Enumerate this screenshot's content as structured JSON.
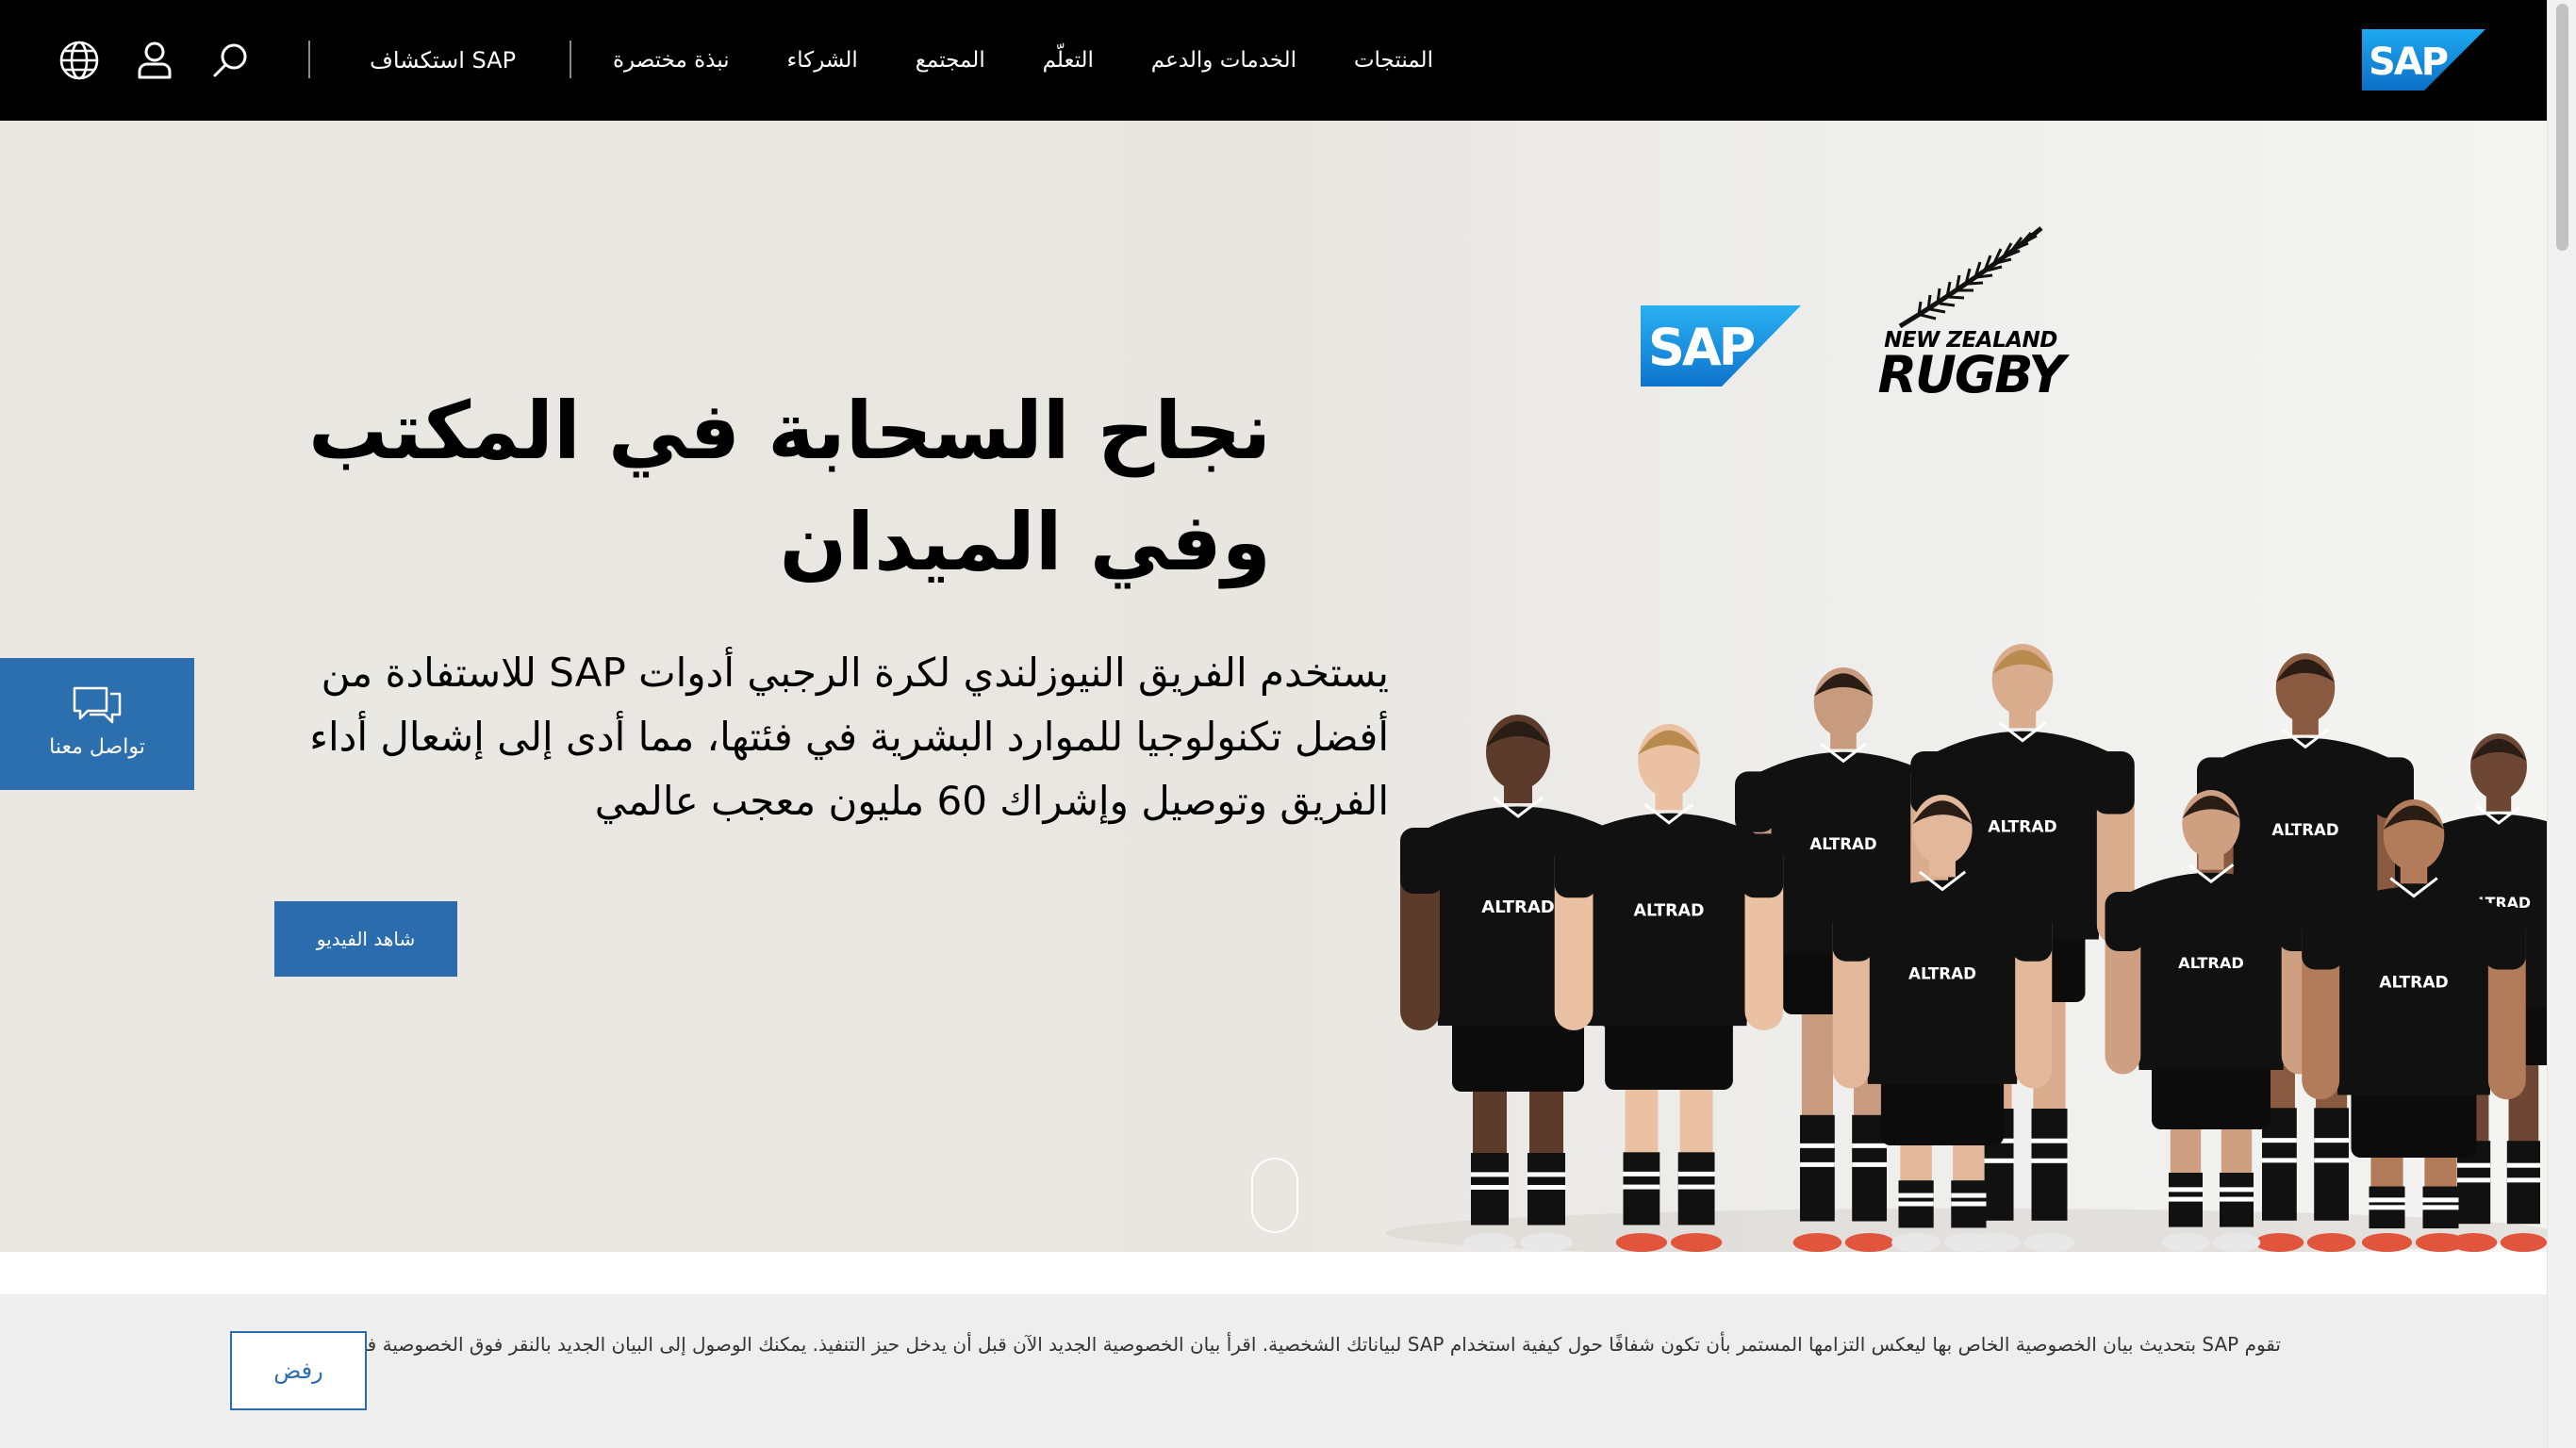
{
  "colors": {
    "nav_bg": "#000000",
    "accent_blue": "#2a6cad",
    "sap_logo_blue": "#1483d6",
    "hero_bg": "#ebe8e3",
    "cookie_bg": "#eeeeee",
    "jersey_black": "#111111"
  },
  "header": {
    "logo_text": "SAP",
    "nav_items": [
      {
        "label": "المنتجات"
      },
      {
        "label": "الخدمات والدعم"
      },
      {
        "label": "التعلّم"
      },
      {
        "label": "المجتمع"
      },
      {
        "label": "الشركاء"
      },
      {
        "label": "نبذة مختصرة"
      }
    ],
    "explore_label": "استكشاف SAP",
    "icons": [
      "search-icon",
      "user-icon",
      "globe-icon"
    ]
  },
  "hero": {
    "title": "نجاح السحابة في المكتب وفي الميدان",
    "subtitle": "يستخدم الفريق النيوزلندي لكرة الرجبي أدوات SAP للاستفادة من أفضل تكنولوجيا للموارد البشرية في فئتها، مما أدى إلى إشعال أداء الفريق وتوصيل وإشراك 60 مليون معجب عالمي",
    "cta_label": "شاهد الفيديو",
    "brand_logo_text": "SAP",
    "partner_logo": {
      "line1": "NEW ZEALAND",
      "line2": "RUGBY"
    },
    "jersey_sponsor": "ALTRAD"
  },
  "contact": {
    "label": "تواصل معنا",
    "icon": "chat-bubbles-icon"
  },
  "cookie_banner": {
    "text": "تقوم SAP بتحديث بيان الخصوصية الخاص بها ليعكس التزامها المستمر بأن تكون شفافًا حول كيفية استخدام SAP لبياناتك الشخصية. اقرأ بيان الخصوصية الجديد الآن قبل أن يدخل حيز التنفيذ. يمكنك الوصول إلى البيان الجديد بالنقر فوق الخصوصية في التذييل",
    "decline_label": "رفض"
  }
}
